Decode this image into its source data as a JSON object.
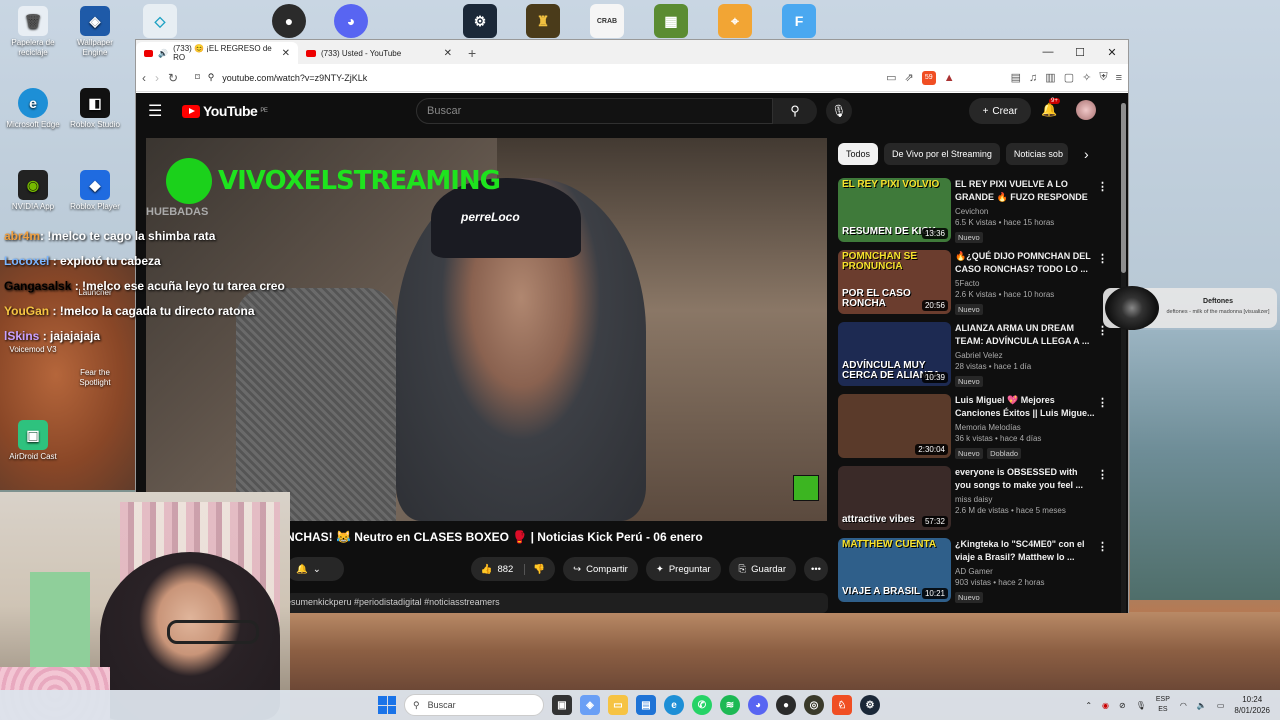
{
  "desktop": {
    "icons": [
      {
        "label": "Papelera de reciclaje"
      },
      {
        "label": "Wallpaper Engine"
      },
      {
        "label": "Microsoft Edge"
      },
      {
        "label": "Roblox Studio"
      },
      {
        "label": "NVIDIA App"
      },
      {
        "label": "Roblox Player"
      },
      {
        "label": "Launcher"
      },
      {
        "label": "Voicemod V3"
      },
      {
        "label": "Fear the Spotlight"
      },
      {
        "label": "AirDroid Cast"
      }
    ],
    "top_icons": [
      "OBS",
      "Discord",
      "Steam",
      "Game",
      "Crab Game",
      "Minecraft",
      "Counter-Strike",
      "F"
    ]
  },
  "browser": {
    "tabs": [
      {
        "label": "(733) 😊 ¡EL REGRESO de RO",
        "active": true
      },
      {
        "label": "(733) Usted - YouTube",
        "active": false
      }
    ],
    "url": "youtube.com/watch?v=z9NTY-ZjKLk",
    "brave_badge": "59"
  },
  "youtube": {
    "logo_text": "YouTube",
    "logo_region": "PE",
    "search_placeholder": "Buscar",
    "create_label": "Crear",
    "notif_count": "9+",
    "video": {
      "channel_overlay": "VIVOXELSTREAMING",
      "faded_text": "HUEBADAS",
      "cap_text": "perreLoco",
      "chat": [
        {
          "user": "abr4m",
          "msg": ": !melco te cago la shimba rata"
        },
        {
          "user": "Locoxel",
          "msg": " : explotó tu cabeza"
        },
        {
          "user": "Gangasalsk",
          "msg": " : !melco ese acuña leyo tu tarea creo"
        },
        {
          "user": "YouGan",
          "msg": " : !melco la cagada tu directo ratona"
        },
        {
          "user": "lSkins",
          "msg": " : jajajajaja"
        }
      ],
      "title": "NCHAS! 😹 Neutro en CLASES BOXEO 🥊 | Noticias Kick Perú - 06 enero",
      "likes": "882",
      "share_label": "Compartir",
      "ask_label": "Preguntar",
      "save_label": "Guardar",
      "description": "esumenkickperu #periodistadigital #noticiasstreamers"
    },
    "chips": [
      "Todos",
      "De Vivo por el Streaming",
      "Noticias sob"
    ],
    "sidebar": [
      {
        "title": "EL REY PIXI VUELVE A LO GRANDE 🔥 FUZO RESPONDE ...",
        "channel": "Cevichon",
        "meta": "6.5 K vistas • hace 15 horas",
        "duration": "13:36",
        "badge": "Nuevo",
        "thumb_top": "EL REY PIXI VOLVIO",
        "thumb_bottom": "RESUMEN DE KICK",
        "bg": "#3f7a3a"
      },
      {
        "title": "🔥¿QUÉ DIJO POMNCHAN DEL CASO RONCHAS? TODO LO ...",
        "channel": "5Facto",
        "meta": "2.6 K vistas • hace 10 horas",
        "duration": "20:56",
        "badge": "Nuevo",
        "thumb_top": "POMNCHAN SE PRONUNCIA",
        "thumb_bottom": "POR EL CASO RONCHA",
        "bg": "#6b3d2e"
      },
      {
        "title": "ALIANZA ARMA UN DREAM TEAM: ADVÍNCULA LLEGA A ...",
        "channel": "Gabriel Velez",
        "meta": "28 vistas • hace 1 día",
        "duration": "10:39",
        "badge": "Nuevo",
        "thumb_top": "",
        "thumb_bottom": "ADVÍNCULA MUY CERCA DE ALIANZA",
        "bg": "#1d2a52"
      },
      {
        "title": "Luis Miguel 💖 Mejores Canciones Éxitos || Luis Migue...",
        "channel": "Memoria Melodías",
        "meta": "36 k vistas • hace 4 días",
        "duration": "2:30:04",
        "badge": "Nuevo",
        "badge2": "Doblado",
        "thumb_top": "",
        "thumb_bottom": "",
        "bg": "#5a3a2a"
      },
      {
        "title": "everyone is OBSESSED with you songs to make you feel ...",
        "channel": "miss daisy",
        "meta": "2.6 M de vistas • hace 5 meses",
        "duration": "57:32",
        "badge": "",
        "thumb_top": "",
        "thumb_bottom": "attractive vibes",
        "bg": "#3a2a28"
      },
      {
        "title": "¿Kingteka lo \"SC4ME0\" con el viaje a Brasil? Matthew lo ...",
        "channel": "AD Gamer",
        "meta": "903 vistas • hace 2 horas",
        "duration": "10:21",
        "badge": "Nuevo",
        "thumb_top": "MATTHEW CUENTA",
        "thumb_bottom": "VIAJE A BRASIL",
        "bg": "#2f5f8a"
      }
    ]
  },
  "media_popup": {
    "title": "Deftones",
    "subtitle": "deftones - milk of the madonna [visualizer]"
  },
  "taskbar": {
    "search": "Buscar",
    "lang": "ESP",
    "lang2": "ES",
    "time": "10:24",
    "date": "8/01/2026"
  }
}
